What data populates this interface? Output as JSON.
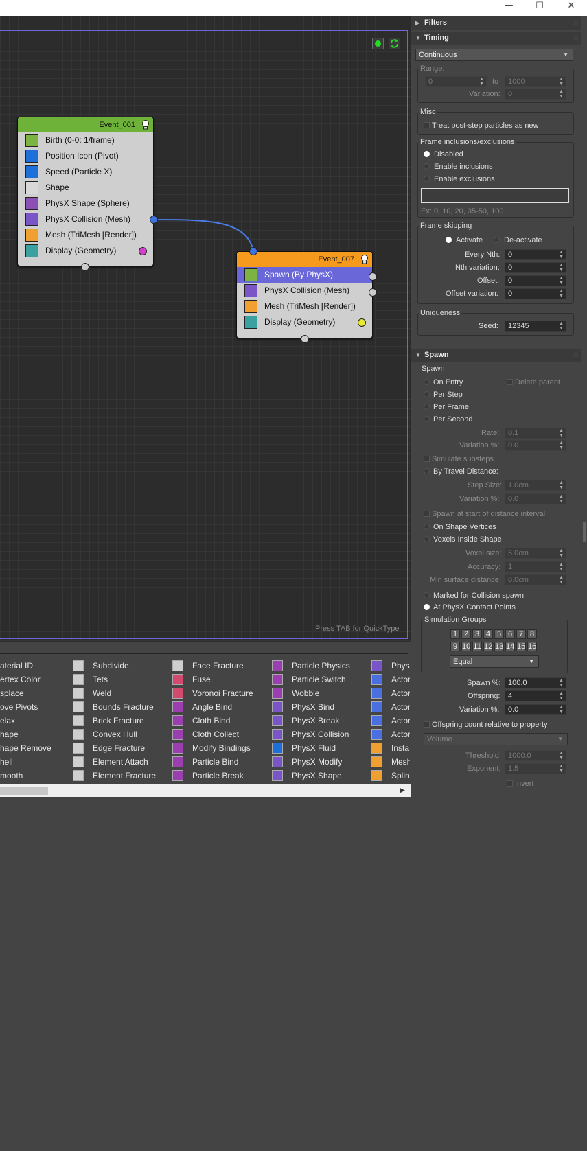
{
  "window": {
    "minimize": "—",
    "maximize": "☐",
    "close": "✕"
  },
  "viewport": {
    "quicktype_hint": "Press TAB for QuickType"
  },
  "event1": {
    "title": "Event_001",
    "ops": [
      "Birth (0-0: 1/frame)",
      "Position Icon (Pivot)",
      "Speed (Particle X)",
      "Shape",
      "PhysX Shape (Sphere)",
      "PhysX Collision (Mesh)",
      "Mesh (TriMesh [Render])",
      "Display (Geometry)"
    ]
  },
  "event7": {
    "title": "Event_007",
    "ops": [
      "Spawn (By PhysX)",
      "PhysX Collision (Mesh)",
      "Mesh (TriMesh [Render])",
      "Display (Geometry)"
    ]
  },
  "depot": {
    "col1": [
      "aterial ID",
      "ertex Color",
      "splace",
      "ove Pivots",
      "elax",
      "hape",
      "hape Remove",
      "hell",
      "mooth"
    ],
    "col2": [
      "Subdivide",
      "Tets",
      "Weld",
      "Bounds Fracture",
      "Brick Fracture",
      "Convex Hull",
      "Edge Fracture",
      "Element Attach",
      "Element Fracture"
    ],
    "col3": [
      "Face Fracture",
      "Fuse",
      "Voronoi Fracture",
      "Angle Bind",
      "Cloth Bind",
      "Cloth Collect",
      "Modify Bindings",
      "Particle Bind",
      "Particle Break"
    ],
    "col4": [
      "Particle Physics",
      "Particle Switch",
      "Wobble",
      "PhysX Bind",
      "PhysX Break",
      "PhysX Collision",
      "PhysX Fluid",
      "PhysX Modify",
      "PhysX Shape"
    ],
    "col5": [
      "Phys",
      "Actor",
      "Actor",
      "Actor",
      "Actor",
      "Actor",
      "Insta",
      "Mesh",
      "Splin"
    ]
  },
  "panel": {
    "filters": "Filters",
    "timing": {
      "title": "Timing",
      "mode": "Continuous",
      "range_label": "Range:",
      "range_from": "0",
      "to_label": "to",
      "range_to": "1000",
      "variation_label": "Variation:",
      "variation": "0",
      "misc_label": "Misc",
      "treat_label": "Treat post-step particles as new",
      "frameinc_label": "Frame inclusions/exclusions",
      "disabled": "Disabled",
      "enable_inc": "Enable inclusions",
      "enable_exc": "Enable exclusions",
      "frame_input": "",
      "example": "Ex: 0, 10, 20, 35-50, 100",
      "skip_label": "Frame skipping",
      "activate": "Activate",
      "deactivate": "De-activate",
      "every_nth_label": "Every Nth:",
      "every_nth": "0",
      "nth_var_label": "Nth variation:",
      "nth_var": "0",
      "offset_label": "Offset:",
      "offset": "0",
      "offset_var_label": "Offset variation:",
      "offset_var": "0",
      "uniq_label": "Uniqueness",
      "seed_label": "Seed:",
      "seed": "12345"
    },
    "spawn": {
      "title": "Spawn",
      "group_label": "Spawn",
      "on_entry": "On Entry",
      "delete_parent": "Delete parent",
      "per_step": "Per Step",
      "per_frame": "Per Frame",
      "per_second": "Per Second",
      "rate_label": "Rate:",
      "rate": "0.1",
      "variation_pct_label": "Variation %:",
      "variation_pct": "0.0",
      "simulate_substeps": "Simulate substeps",
      "by_travel": "By Travel Distance:",
      "step_size_label": "Step Size:",
      "step_size": "1.0cm",
      "variation2_label": "Variation %:",
      "variation2": "0.0",
      "spawn_start": "Spawn at start of distance interval",
      "on_vertices": "On Shape Vertices",
      "voxels": "Voxels Inside Shape",
      "voxel_size_label": "Voxel size:",
      "voxel_size": "5.0cm",
      "accuracy_label": "Accuracy:",
      "accuracy": "1",
      "min_surface_label": "Min surface distance:",
      "min_surface": "0.0cm",
      "marked": "Marked for Collision spawn",
      "at_contact": "At PhysX Contact Points",
      "sim_groups_label": "Simulation Groups",
      "groups": [
        "1",
        "2",
        "3",
        "4",
        "5",
        "6",
        "7",
        "8",
        "9",
        "10",
        "11",
        "12",
        "13",
        "14",
        "15",
        "16"
      ],
      "equal": "Equal",
      "spawn_pct_label": "Spawn %:",
      "spawn_pct": "100.0",
      "offspring_label": "Offspring:",
      "offspring": "4",
      "variation3_label": "Variation %:",
      "variation3": "0.0",
      "offspring_rel": "Offspring count relative to property",
      "volume": "Volume",
      "threshold_label": "Threshold:",
      "threshold": "1000.0",
      "exponent_label": "Exponent:",
      "exponent": "1.5",
      "invert": "Invert"
    }
  }
}
